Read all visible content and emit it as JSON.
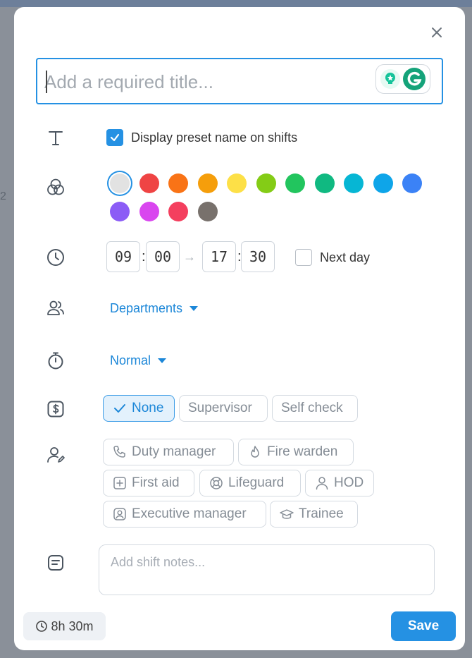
{
  "backdrop": {
    "side_number": "2"
  },
  "title": {
    "placeholder": "Add a required title..."
  },
  "preset": {
    "checkbox_label": "Display preset name on shifts",
    "checked": true
  },
  "colors": {
    "selected": "#e2e2e2",
    "swatches": [
      "#e2e2e2",
      "#ef4444",
      "#f97316",
      "#f59e0b",
      "#fde047",
      "#84cc16",
      "#22c55e",
      "#10b981",
      "#06b6d4",
      "#0ea5e9",
      "#3b82f6",
      "#8b5cf6",
      "#d946ef",
      "#f43f5e",
      "#78716c"
    ]
  },
  "time": {
    "start_hour": "09",
    "start_minute": "00",
    "end_hour": "17",
    "end_minute": "30",
    "separator": ":",
    "arrow": "→",
    "next_day_label": "Next day",
    "next_day_checked": false
  },
  "departments": {
    "label": "Departments"
  },
  "break_type": {
    "label": "Normal"
  },
  "role_level": {
    "options": [
      "None",
      "Supervisor",
      "Self check"
    ],
    "selected": "None"
  },
  "special_roles": {
    "items": [
      {
        "label": "Duty manager",
        "icon": "phone-icon"
      },
      {
        "label": "Fire warden",
        "icon": "flame-icon"
      },
      {
        "label": "First aid",
        "icon": "plus-square-icon"
      },
      {
        "label": "Lifeguard",
        "icon": "lifebuoy-icon"
      },
      {
        "label": "HOD",
        "icon": "person-icon"
      },
      {
        "label": "Executive manager",
        "icon": "portrait-icon"
      },
      {
        "label": "Trainee",
        "icon": "graduation-cap-icon"
      }
    ]
  },
  "notes": {
    "placeholder": "Add shift notes..."
  },
  "footer": {
    "duration": "8h 30m",
    "save_label": "Save"
  },
  "theme": {
    "accent": "#2591e3",
    "icon_color": "#4b5560"
  }
}
